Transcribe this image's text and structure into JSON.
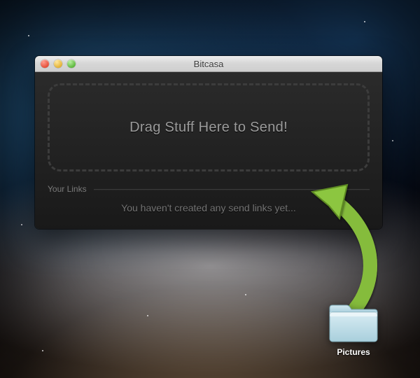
{
  "window": {
    "title": "Bitcasa",
    "dropzone_text": "Drag Stuff Here to Send!",
    "links_section_label": "Your Links",
    "links_empty_text": "You haven't created any send links yet..."
  },
  "desktop": {
    "folder_label": "Pictures"
  },
  "colors": {
    "arrow": "#8cc63f"
  }
}
